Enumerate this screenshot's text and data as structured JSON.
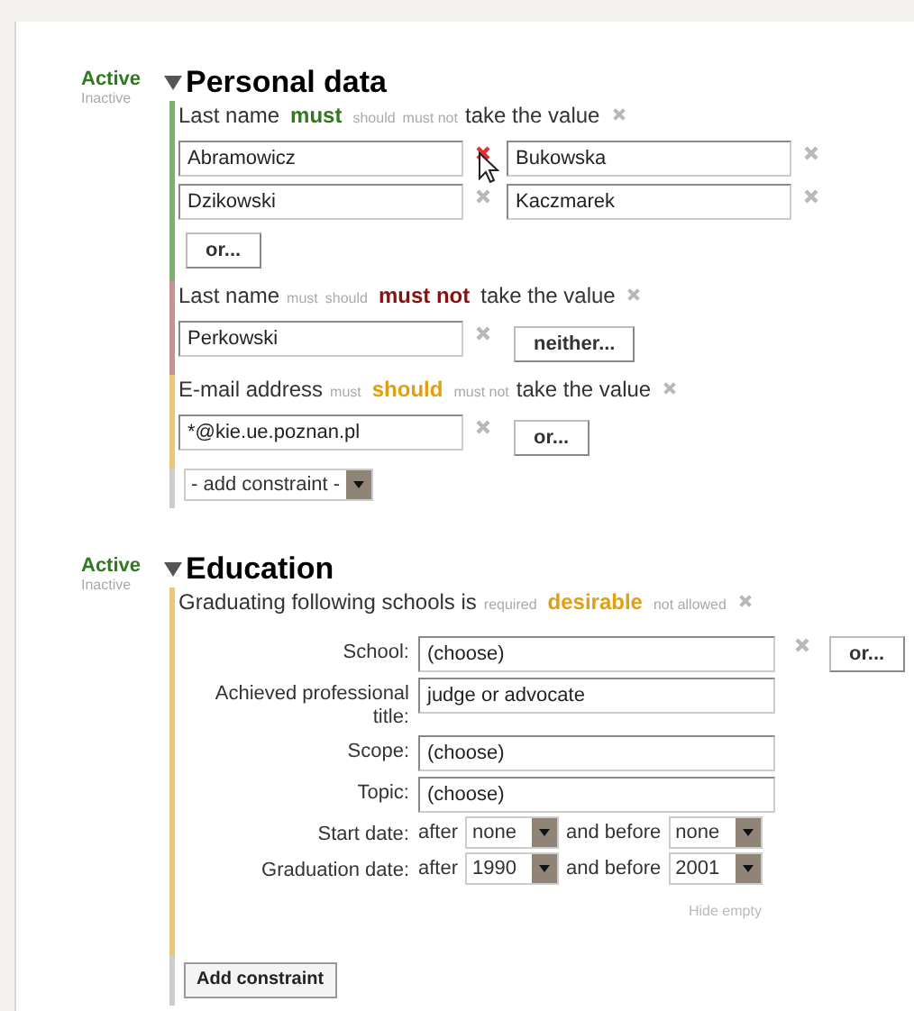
{
  "sections": [
    {
      "status_options": [
        {
          "label": "Active",
          "selected": true
        },
        {
          "label": "Inactive",
          "selected": false
        }
      ],
      "expanded": true,
      "title": "Personal data",
      "constraints": [
        {
          "kind": "values",
          "subject": "Last name",
          "modalities": [
            {
              "label": "must",
              "selected": true,
              "kind": "must"
            },
            {
              "label": "should",
              "selected": false,
              "kind": "should"
            },
            {
              "label": "must not",
              "selected": false,
              "kind": "must_not"
            }
          ],
          "suffix": "take the value",
          "values": [
            {
              "text": "Abramowicz",
              "hovered": true
            },
            {
              "text": "Bukowska",
              "hovered": false
            },
            {
              "text": "Dzikowski",
              "hovered": false
            },
            {
              "text": "Kaczmarek",
              "hovered": false
            }
          ],
          "button": "or..."
        },
        {
          "kind": "values",
          "subject": "Last name",
          "modalities": [
            {
              "label": "must",
              "selected": false,
              "kind": "must"
            },
            {
              "label": "should",
              "selected": false,
              "kind": "should"
            },
            {
              "label": "must not",
              "selected": true,
              "kind": "must_not"
            }
          ],
          "suffix": "take the value",
          "values": [
            {
              "text": "Perkowski",
              "hovered": false
            }
          ],
          "button": "neither..."
        },
        {
          "kind": "values",
          "subject": "E-mail address",
          "modalities": [
            {
              "label": "must",
              "selected": false,
              "kind": "must"
            },
            {
              "label": "should",
              "selected": true,
              "kind": "should"
            },
            {
              "label": "must not",
              "selected": false,
              "kind": "must_not"
            }
          ],
          "suffix": "take the value",
          "values": [
            {
              "text": "*@kie.ue.poznan.pl",
              "hovered": false
            }
          ],
          "button": "or..."
        }
      ],
      "add": {
        "kind": "select",
        "label": "- add constraint -"
      }
    },
    {
      "status_options": [
        {
          "label": "Active",
          "selected": true
        },
        {
          "label": "Inactive",
          "selected": false
        }
      ],
      "expanded": true,
      "title": "Education",
      "constraints": [
        {
          "kind": "fields",
          "subject": "Graduating following schools is",
          "modalities": [
            {
              "label": "required",
              "selected": false,
              "kind": "must"
            },
            {
              "label": "desirable",
              "selected": true,
              "kind": "should"
            },
            {
              "label": "not allowed",
              "selected": false,
              "kind": "must_not"
            }
          ],
          "fields": [
            {
              "kind": "input",
              "label": "School:",
              "value": "(choose)",
              "removable": true,
              "button": "or..."
            },
            {
              "kind": "input",
              "label": "Achieved professional title:",
              "value": "judge or advocate"
            },
            {
              "kind": "input",
              "label": "Scope:",
              "value": "(choose)"
            },
            {
              "kind": "input",
              "label": "Topic:",
              "value": "(choose)"
            },
            {
              "kind": "range",
              "label": "Start date:",
              "after": "after",
              "from": "none",
              "before": "and before",
              "to": "none"
            },
            {
              "kind": "range",
              "label": "Graduation date:",
              "after": "after",
              "from": "1990",
              "before": "and before",
              "to": "2001"
            }
          ],
          "link": "Hide empty"
        }
      ],
      "add": {
        "kind": "button",
        "label": "Add constraint"
      }
    }
  ]
}
